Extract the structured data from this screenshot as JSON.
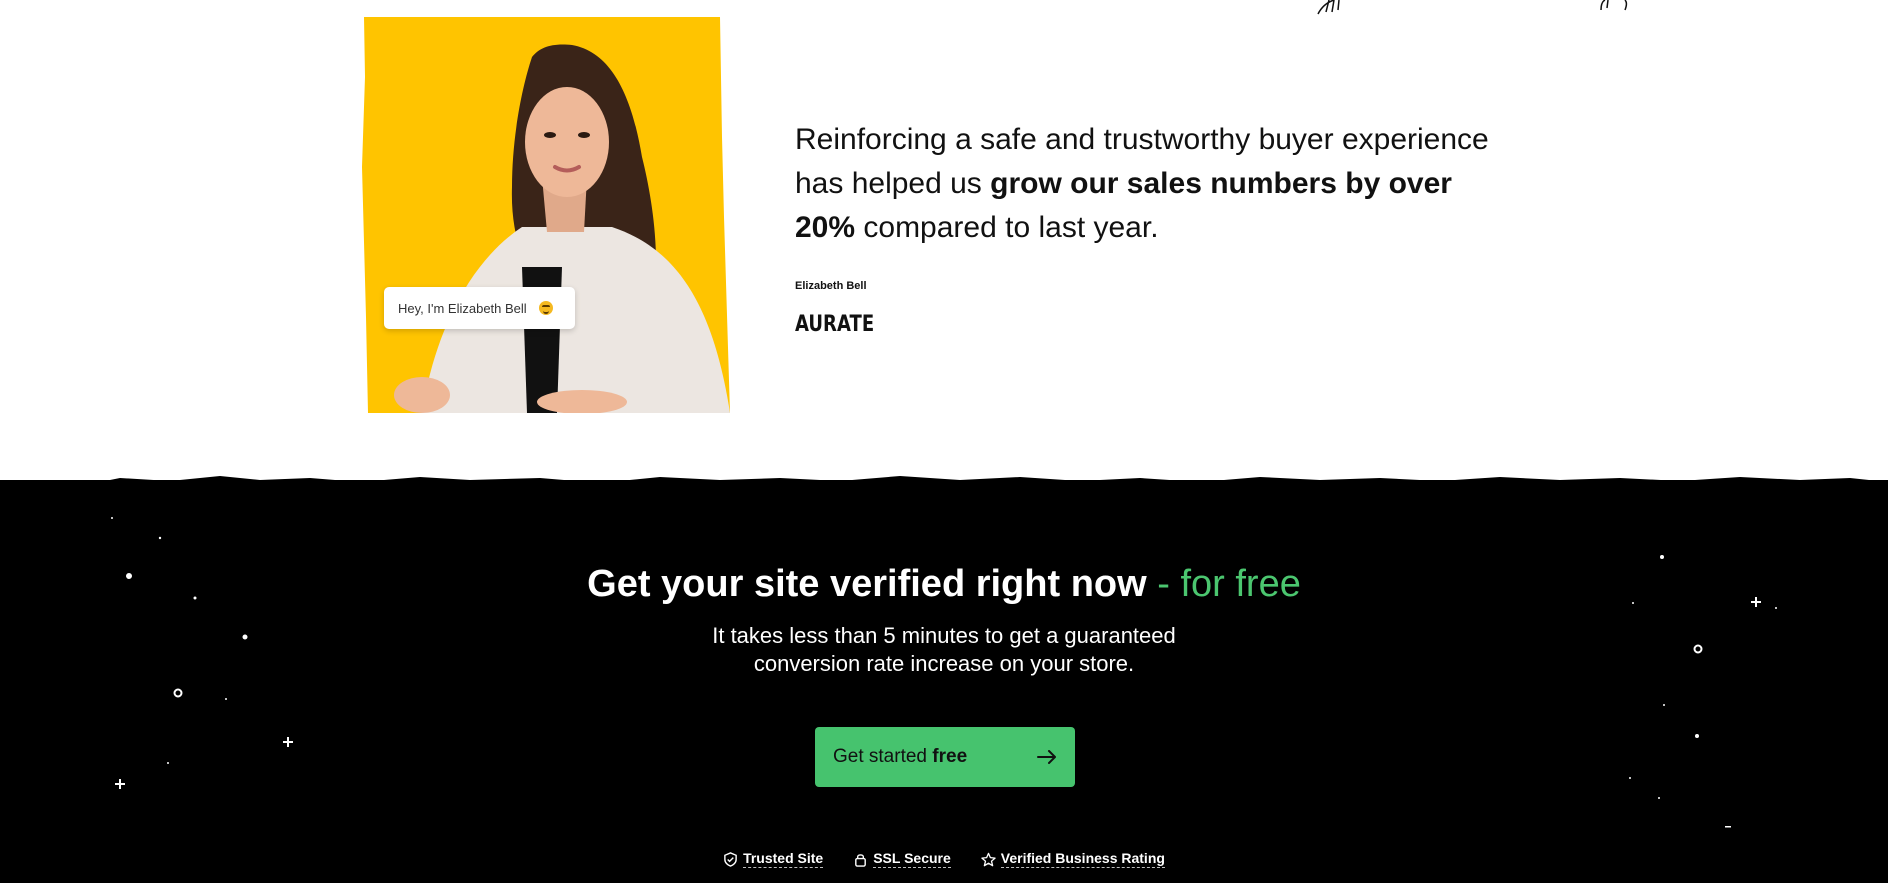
{
  "testimonial": {
    "bubble_text": "Hey, I'm Elizabeth Bell",
    "quote_plain_1": "Reinforcing a safe and trustworthy buyer experience has helped us ",
    "quote_bold": "grow our sales numbers by over 20%",
    "quote_plain_2": " compared to last year.",
    "author": "Elizabeth Bell",
    "brand": "AURATE",
    "colors": {
      "photo_bg": "#ffc400"
    }
  },
  "cta": {
    "title_main": "Get your site verified right now",
    "title_accent": " - for free",
    "subtitle": "It takes less than 5 minutes to get a guaranteed conversion rate increase on your store.",
    "button": {
      "label_plain": "Get started ",
      "label_bold": "free",
      "icon": "arrow-right-icon"
    },
    "badges": [
      {
        "label": "Trusted Site",
        "icon": "shield-check-icon"
      },
      {
        "label": "SSL Secure",
        "icon": "lock-icon"
      },
      {
        "label": "Verified Business Rating",
        "icon": "star-icon"
      }
    ],
    "colors": {
      "background": "#000000",
      "accent": "#4bc66f",
      "button": "#46c36e"
    }
  }
}
